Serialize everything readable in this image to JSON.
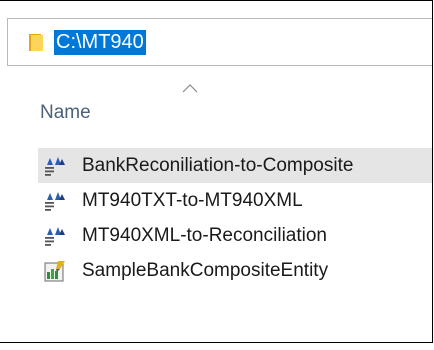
{
  "address_bar": {
    "path": "C:\\MT940",
    "icon": "folder-icon"
  },
  "columns": {
    "name_label": "Name",
    "sort_direction": "ascending"
  },
  "files": [
    {
      "name": "BankReconiliation-to-Composite",
      "icon": "transform-icon",
      "selected": true
    },
    {
      "name": "MT940TXT-to-MT940XML",
      "icon": "transform-icon",
      "selected": false
    },
    {
      "name": "MT940XML-to-Reconciliation",
      "icon": "transform-icon",
      "selected": false
    },
    {
      "name": "SampleBankCompositeEntity",
      "icon": "entity-document-icon",
      "selected": false
    }
  ],
  "colors": {
    "selection_highlight": "#0078d7",
    "row_highlight": "#e5e5e5",
    "header_text": "#4c607a"
  }
}
